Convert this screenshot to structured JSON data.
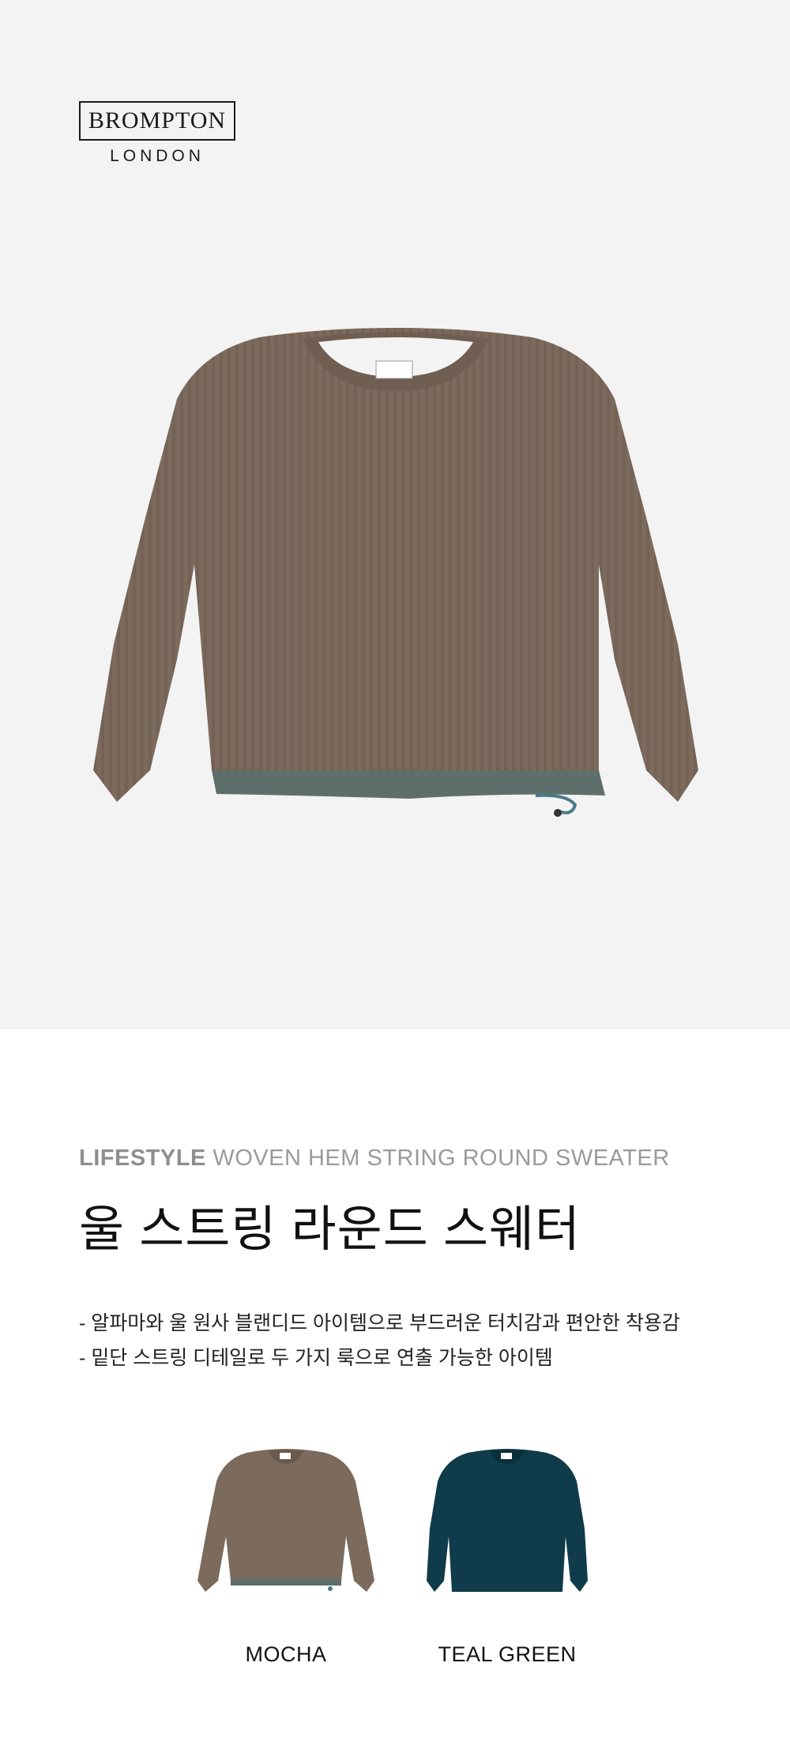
{
  "brand": {
    "name": "BROMPTON",
    "location": "LONDON"
  },
  "product": {
    "category": "LIFESTYLE",
    "english_name": "WOVEN HEM STRING ROUND SWEATER",
    "korean_name": "울 스트링 라운드 스웨터",
    "descriptions": [
      "- 알파마와 울 원사 블랜디드 아이템으로 부드러운 터치감과 편안한 착용감",
      "- 밑단 스트링 디테일로 두 가지 룩으로 연출 가능한 아이템"
    ]
  },
  "colors": {
    "hero_background": "#f3f3f3",
    "mocha": "#7c6b5d",
    "teal_green": "#0f3b4a",
    "hem_band": "#5e6e6b"
  },
  "swatches": [
    {
      "label": "MOCHA",
      "color": "#7c6b5d"
    },
    {
      "label": "TEAL GREEN",
      "color": "#0f3b4a"
    }
  ]
}
